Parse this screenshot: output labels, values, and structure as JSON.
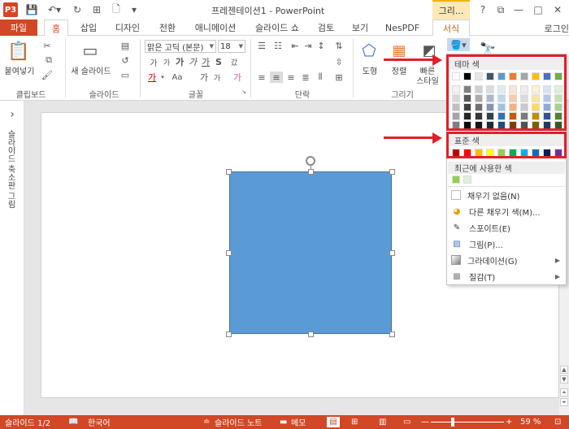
{
  "window": {
    "title": "프레젠테이션1 - PowerPoint",
    "app_badge": "P3",
    "context_group": "그리...",
    "help": "?",
    "restore": "⧉",
    "minimize": "—",
    "maximize": "□",
    "close": "✕"
  },
  "tabs": [
    "파일",
    "홈",
    "삽입",
    "디자인",
    "전환",
    "애니메이션",
    "슬라이드 쇼",
    "검토",
    "보기",
    "NesPDF",
    "서식"
  ],
  "login_label": "로그인",
  "ribbon": {
    "clipboard": {
      "paste": "붙여넣기",
      "label": "클립보드"
    },
    "slides": {
      "new_slide": "새 슬라이드",
      "label": "슬라이드"
    },
    "font": {
      "font_name": "맑은 고딕 (본문)",
      "font_size": "18",
      "label": "글꼴",
      "grow": "가",
      "shrink": "가",
      "bold": "가",
      "italic": "가",
      "underline": "가",
      "strike": "S",
      "spacing": "AV",
      "case": "Aa",
      "clear": "가",
      "color": "가",
      "highlight": "가",
      "big": "가",
      "char_space": "갔"
    },
    "paragraph": {
      "label": "단락"
    },
    "drawing": {
      "shapes": "도형",
      "arrange": "정렬",
      "quick_styles_1": "빠른",
      "quick_styles_2": "스타일",
      "label": "그리기"
    }
  },
  "left_pane": {
    "label": "슬라이드 축소판 그림",
    "toggle": "›"
  },
  "dropdown": {
    "theme_header": "테마 색",
    "standard_header": "표준 색",
    "recent_header": "최근에 사용한 색",
    "items": [
      {
        "icon": "no-fill-icon",
        "label": "채우기 없음(N)"
      },
      {
        "icon": "color-wheel-icon",
        "label": "다른 채우기 색(M)..."
      },
      {
        "icon": "eyedropper-icon",
        "label": "스포이트(E)"
      },
      {
        "icon": "picture-icon",
        "label": "그림(P)..."
      },
      {
        "icon": "gradient-icon",
        "label": "그라데이션(G)"
      },
      {
        "icon": "texture-icon",
        "label": "질감(T)"
      }
    ],
    "theme_row": [
      "#ffffff",
      "#000000",
      "#e7e6e6",
      "#44546a",
      "#5b9bd5",
      "#ed7d31",
      "#a5a5a5",
      "#ffc000",
      "#4472c4",
      "#70ad47"
    ],
    "theme_shades": [
      [
        "#f2f2f2",
        "#7f7f7f",
        "#d0cece",
        "#d6dce4",
        "#deebf6",
        "#fbe5d5",
        "#ededed",
        "#fff2cc",
        "#dae3f3",
        "#e2efd9"
      ],
      [
        "#d8d8d8",
        "#595959",
        "#aeabab",
        "#adb9ca",
        "#bdd7ee",
        "#f7cbac",
        "#dbdbdb",
        "#fee599",
        "#b4c6e7",
        "#c5e0b3"
      ],
      [
        "#bfbfbf",
        "#3f3f3f",
        "#757070",
        "#8496b0",
        "#9cc3e5",
        "#f4b183",
        "#c9c9c9",
        "#ffd965",
        "#8eaadb",
        "#a8d08d"
      ],
      [
        "#a5a5a5",
        "#262626",
        "#3a3838",
        "#323f4f",
        "#2e75b5",
        "#c55a11",
        "#7b7b7b",
        "#bf9000",
        "#2f5496",
        "#538135"
      ],
      [
        "#7f7f7f",
        "#0c0c0c",
        "#171616",
        "#222a35",
        "#1e4e79",
        "#833c0b",
        "#525252",
        "#7f6000",
        "#1f3864",
        "#375623"
      ]
    ],
    "standard_row": [
      "#c00000",
      "#ff0000",
      "#ffc000",
      "#ffff00",
      "#92d050",
      "#00b050",
      "#00b0f0",
      "#0070c0",
      "#002060",
      "#7030a0"
    ],
    "recent_row": [
      "#92d050",
      "#e2efd9"
    ]
  },
  "status": {
    "slide_info": "슬라이드 1/2",
    "language": "한국어",
    "notes": "슬라이드 노트",
    "comments": "메모",
    "zoom": "59 %",
    "zoom_level": 0.59
  }
}
